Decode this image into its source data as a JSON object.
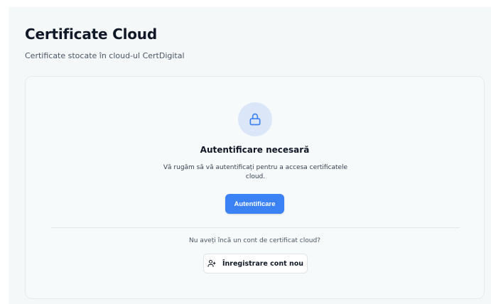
{
  "header": {
    "title": "Certificate Cloud",
    "subtitle": "Certificate stocate în cloud-ul CertDigital"
  },
  "auth_card": {
    "icon": "lock-icon",
    "title": "Autentificare necesară",
    "description": "Vă rugăm să vă autentificați pentru a accesa certificatele cloud.",
    "button_label": "Autentificare",
    "register_question": "Nu aveți încă un cont de certificat cloud?",
    "register_icon": "user-plus-icon",
    "register_label": "Înregistrare cont nou"
  },
  "colors": {
    "accent": "#3b82f6",
    "icon_bg": "#dbe7f8",
    "panel_bg": "#f4f8f9"
  }
}
